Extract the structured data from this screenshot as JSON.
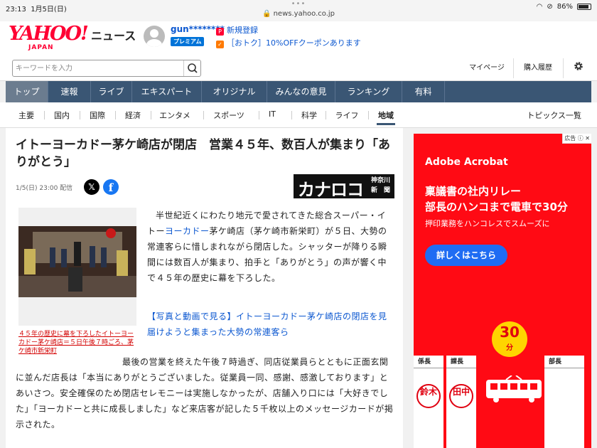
{
  "statusbar": {
    "time": "23:13",
    "date": "1月5日(日)",
    "url": "news.yahoo.co.jp",
    "battery": "86%",
    "battery_level": 0.86
  },
  "header": {
    "logo_text": "YAHOO!",
    "logo_sub": "JAPAN",
    "service_name": "ニュース",
    "username": "gun********",
    "premium_badge": "プレミアム",
    "signup_link": "新規登録",
    "coupon_link": "［おトク］10%OFFクーポンあります"
  },
  "search": {
    "placeholder": "キーワードを入力",
    "value": "",
    "mypage": "マイページ",
    "history": "購入履歴"
  },
  "global_nav": [
    {
      "label": "トップ",
      "active": true
    },
    {
      "label": "速報",
      "active": false
    },
    {
      "label": "ライブ",
      "active": false
    },
    {
      "label": "エキスパート",
      "active": false
    },
    {
      "label": "オリジナル",
      "active": false
    },
    {
      "label": "みんなの意見",
      "active": false
    },
    {
      "label": "ランキング",
      "active": false
    },
    {
      "label": "有料",
      "active": false
    }
  ],
  "category_nav": {
    "items": [
      {
        "label": "主要",
        "active": false
      },
      {
        "label": "国内",
        "active": false
      },
      {
        "label": "国際",
        "active": false
      },
      {
        "label": "経済",
        "active": false
      },
      {
        "label": "エンタメ",
        "active": false
      },
      {
        "label": "スポーツ",
        "active": false
      },
      {
        "label": "IT",
        "active": false
      },
      {
        "label": "科学",
        "active": false
      },
      {
        "label": "ライフ",
        "active": false
      },
      {
        "label": "地域",
        "active": true
      }
    ],
    "topics": "トピックス一覧"
  },
  "article": {
    "headline": "イトーヨーカドー茅ケ崎店が閉店　営業４５年、数百人が集まり「ありがとう」",
    "meta": "1/5(日) 23:00 配信",
    "publisher_main": "カナロコ",
    "publisher_sub1": "神奈川",
    "publisher_sub2": "新　聞",
    "caption": "４５年の歴史に幕を下ろしたイトーヨーカドー茅ケ崎店＝５日午後７時ごろ、茅ケ崎市新栄町",
    "para1_a": "半世紀近くにわたり地元で愛されてきた総合スーパー・イトー",
    "para1_link": "ヨーカドー",
    "para1_b": "茅ケ崎店（茅ケ崎市新栄町）が５日、大勢の常連客らに惜しまれながら閉店した。シャッターが降りる瞬間には数百人が集まり、拍手と「ありがとう」の声が響く中で４５年の歴史に幕を下ろした。",
    "photo_link": "【写真と動画で見る】イトーヨーカドー茅ケ崎店の閉店を見届けようと集まった大勢の常連客ら",
    "para2": "最後の営業を終えた午後７時過ぎ、同店従業員らとともに正面玄関に並んだ店長は「本当にありがとうございました。従業員一同、感謝、感激しております」とあいさつ。安全確保のため閉店セレモニーは実施しなかったが、店舗入り口には「大好きでした」「ヨーカドーと共に成長しました」など来店客が記した５千枚以上のメッセージカードが掲示された。"
  },
  "ad": {
    "label": "広告",
    "brand": "Adobe Acrobat",
    "line1": "稟議書の社内リレー",
    "line2": "部長のハンコまで電車で30分",
    "sub": "押印業務をハンコレスでスムーズに",
    "cta": "詳しくはこちら",
    "badge_number": "30",
    "badge_unit": "分",
    "roles": [
      "係長",
      "課長",
      "部長"
    ],
    "stamps": [
      "鈴木",
      "田中"
    ],
    "colors": {
      "background": "#ff0a14",
      "cta": "#1f6cf3",
      "badge": "#ffd400"
    }
  },
  "colors": {
    "brand_red": "#ff0033",
    "nav_bg": "#3a5674",
    "link_blue": "#0b57d0",
    "caption_red": "#d30000"
  }
}
